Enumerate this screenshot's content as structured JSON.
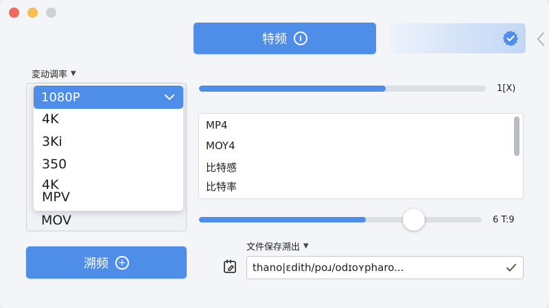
{
  "window": {
    "controls": [
      "close",
      "minimize",
      "maximize"
    ]
  },
  "header": {
    "primary_button_label": "特频",
    "primary_button_icon": "info-icon",
    "settings_icon": "gear-icon",
    "back_icon": "chevron-left-icon"
  },
  "resolution": {
    "label": "変动调率",
    "selected": "1080P",
    "options": [
      "4K",
      "3Ki",
      "350",
      "4K",
      "MPV"
    ],
    "below_option": "MOV"
  },
  "secondary_button": {
    "label": "溯频",
    "icon": "plus-circle-icon"
  },
  "progress": {
    "value_percent": 65,
    "label": "1[X)"
  },
  "format_list": {
    "items": [
      "MP4",
      "MOY4",
      "比特感",
      "比特率"
    ]
  },
  "slider": {
    "value_percent": 59,
    "label": "6 T:9"
  },
  "output": {
    "label": "文件保存溯出",
    "path_value": "thano|ɛdith/poɹ/odɪoʏpharo...",
    "folder_icon": "folder-edit-icon",
    "confirm_icon": "check-icon"
  },
  "colors": {
    "accent": "#4e8ee8",
    "background": "#f4f5f8",
    "track": "#dcdfe4"
  }
}
